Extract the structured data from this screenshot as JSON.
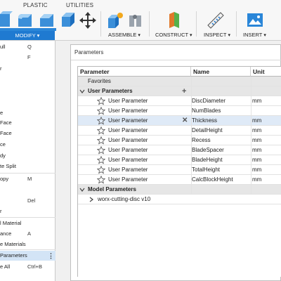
{
  "toolbar": {
    "tabs": [
      "PLASTIC",
      "UTILITIES"
    ],
    "modify_label": "MODIFY",
    "groups": [
      {
        "label": "ASSEMBLE"
      },
      {
        "label": "CONSTRUCT"
      },
      {
        "label": "INSPECT"
      },
      {
        "label": "INSERT"
      }
    ],
    "colors": {
      "accent": "#1f7ad1",
      "assemble": "#f2a81d",
      "construct": "#e0782a",
      "inspect": "#1f7ad1"
    }
  },
  "menu": {
    "items": [
      {
        "label": "ull",
        "key": "Q"
      },
      {
        "label": "",
        "key": "F"
      },
      {
        "label": "r",
        "key": ""
      },
      {
        "label": "",
        "key": ""
      },
      {
        "label": "e",
        "key": ""
      },
      {
        "label": "Face",
        "key": ""
      },
      {
        "label": "Face",
        "key": ""
      },
      {
        "label": "ce",
        "key": ""
      },
      {
        "label": "dy",
        "key": ""
      },
      {
        "label": "te Split",
        "key": ""
      },
      {
        "label": "opy",
        "key": "M"
      },
      {
        "label": "",
        "key": ""
      },
      {
        "label": "",
        "key": "Del"
      },
      {
        "label": "r",
        "key": ""
      },
      {
        "label": "l Material",
        "key": ""
      },
      {
        "label": "ance",
        "key": "A"
      },
      {
        "label": "e Materials",
        "key": ""
      },
      {
        "label": "Parameters",
        "key": ""
      },
      {
        "label": "e All",
        "key": "Ctrl+B"
      }
    ]
  },
  "dialog": {
    "title": "Parameters",
    "columns": {
      "parameter": "Parameter",
      "name": "Name",
      "unit": "Unit"
    },
    "favorites_label": "Favorites",
    "user_group_label": "User Parameters",
    "user_params": [
      {
        "type": "User Parameter",
        "name": "DiscDiameter",
        "unit": "mm"
      },
      {
        "type": "User Parameter",
        "name": "NumBlades",
        "unit": ""
      },
      {
        "type": "User Parameter",
        "name": "Thickness",
        "unit": "mm"
      },
      {
        "type": "User Parameter",
        "name": "DetailHeight",
        "unit": "mm"
      },
      {
        "type": "User Parameter",
        "name": "Recess",
        "unit": "mm"
      },
      {
        "type": "User Parameter",
        "name": "BladeSpacer",
        "unit": "mm"
      },
      {
        "type": "User Parameter",
        "name": "BladeHeight",
        "unit": "mm"
      },
      {
        "type": "User Parameter",
        "name": "TotalHeight",
        "unit": "mm"
      },
      {
        "type": "User Parameter",
        "name": "CalcBlockHeight",
        "unit": "mm"
      }
    ],
    "model_group_label": "Model Parameters",
    "model_item_label": "worx-cutting-disc v10"
  }
}
